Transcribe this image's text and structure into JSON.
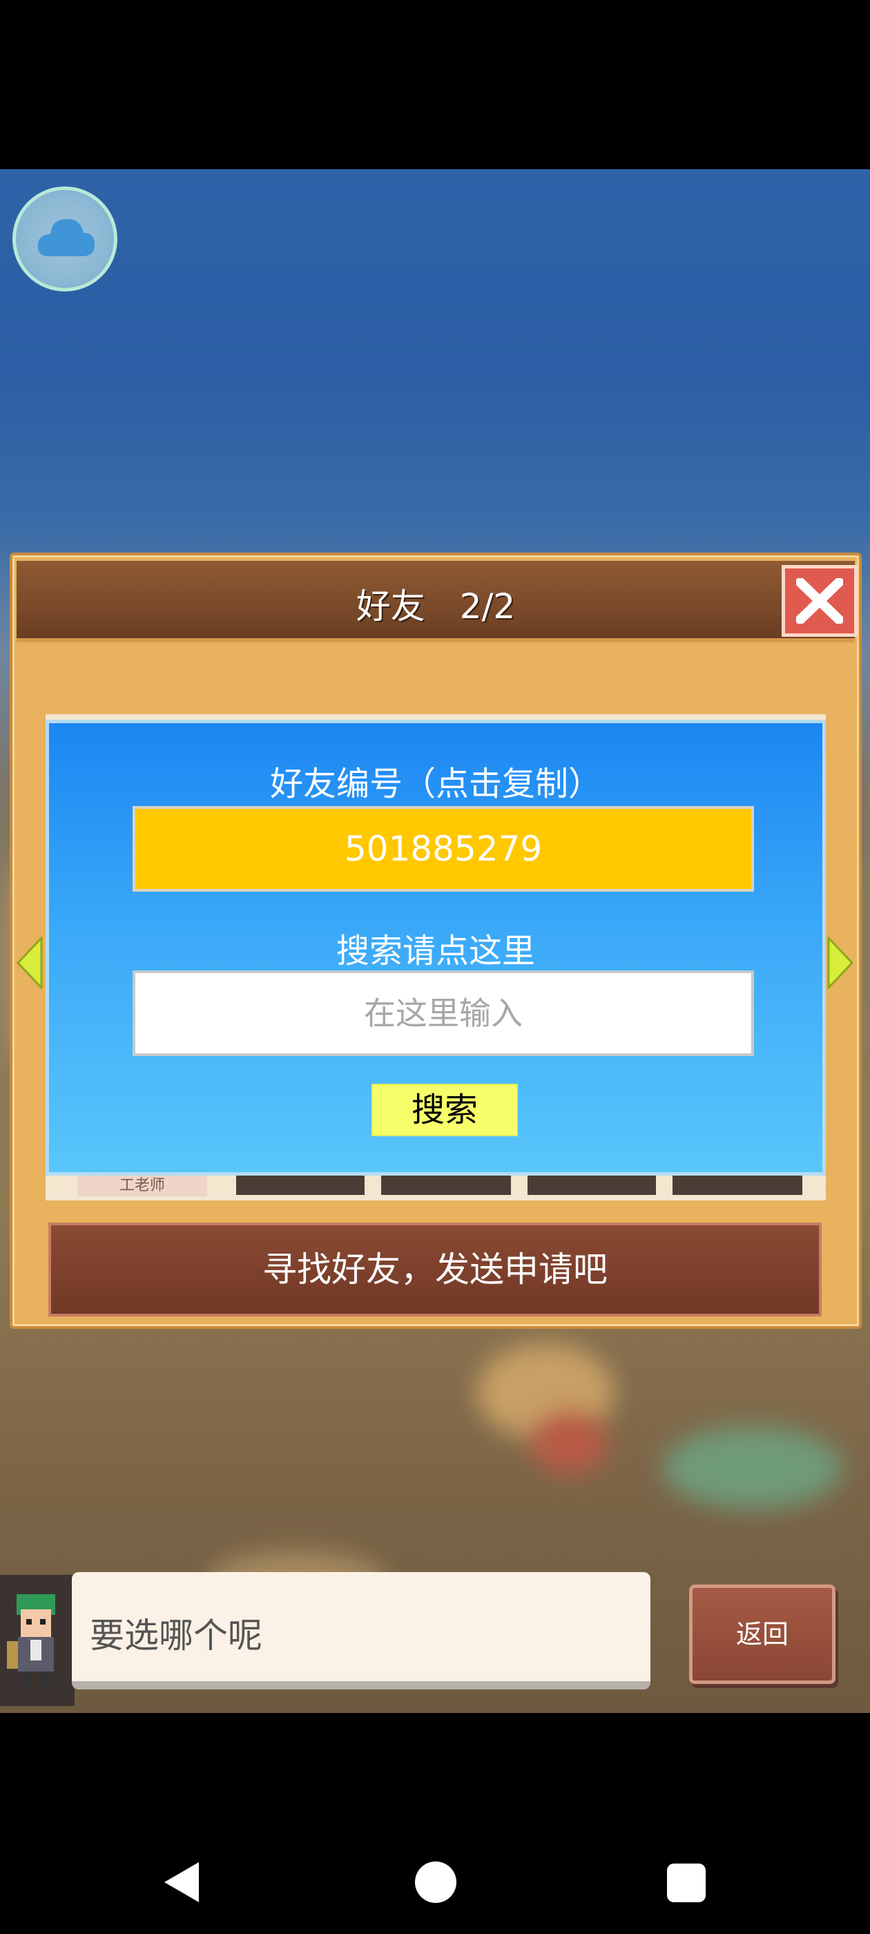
{
  "dialog": {
    "title": "好友　2/2",
    "friend_id_label": "好友编号（点击复制）",
    "friend_id": "501885279",
    "search_hint": "搜索请点这里",
    "search_placeholder": "在这里输入",
    "search_button": "搜索",
    "list_slot_label": "工老师",
    "footer": "寻找好友，发送申请吧"
  },
  "npc": {
    "message": "要选哪个呢"
  },
  "back_button": "返回",
  "nav": {
    "back_icon": "triangle-back-icon",
    "home_icon": "circle-home-icon",
    "recents_icon": "square-recents-icon"
  }
}
